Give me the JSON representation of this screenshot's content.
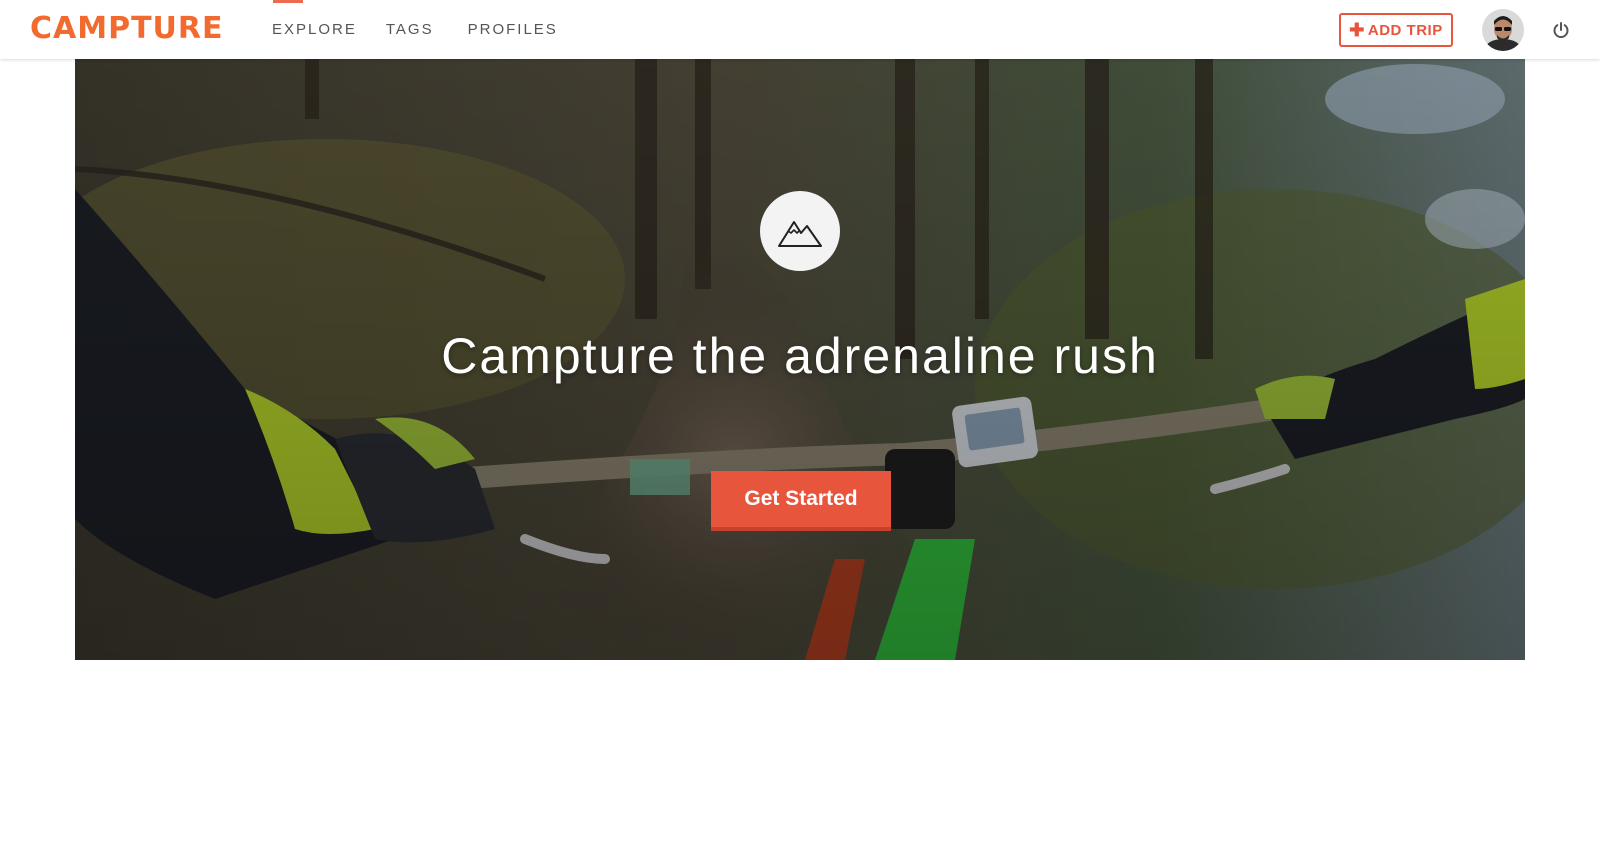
{
  "brand": {
    "logo_text": "CAMPTURE",
    "accent": "#e8553d",
    "logo_color": "#f26a2e"
  },
  "nav": {
    "items": [
      {
        "label": "EXPLORE",
        "active": true
      },
      {
        "label": "TAGS",
        "active": false
      },
      {
        "label": "PROFILES",
        "active": false
      }
    ],
    "add_trip_label": "ADD TRIP",
    "add_trip_icon": "plus-icon",
    "user_avatar": "user-avatar",
    "power_icon": "power-icon"
  },
  "hero": {
    "icon": "mountain-icon",
    "title": "Campture the adrenaline rush",
    "cta_label": "Get Started"
  }
}
